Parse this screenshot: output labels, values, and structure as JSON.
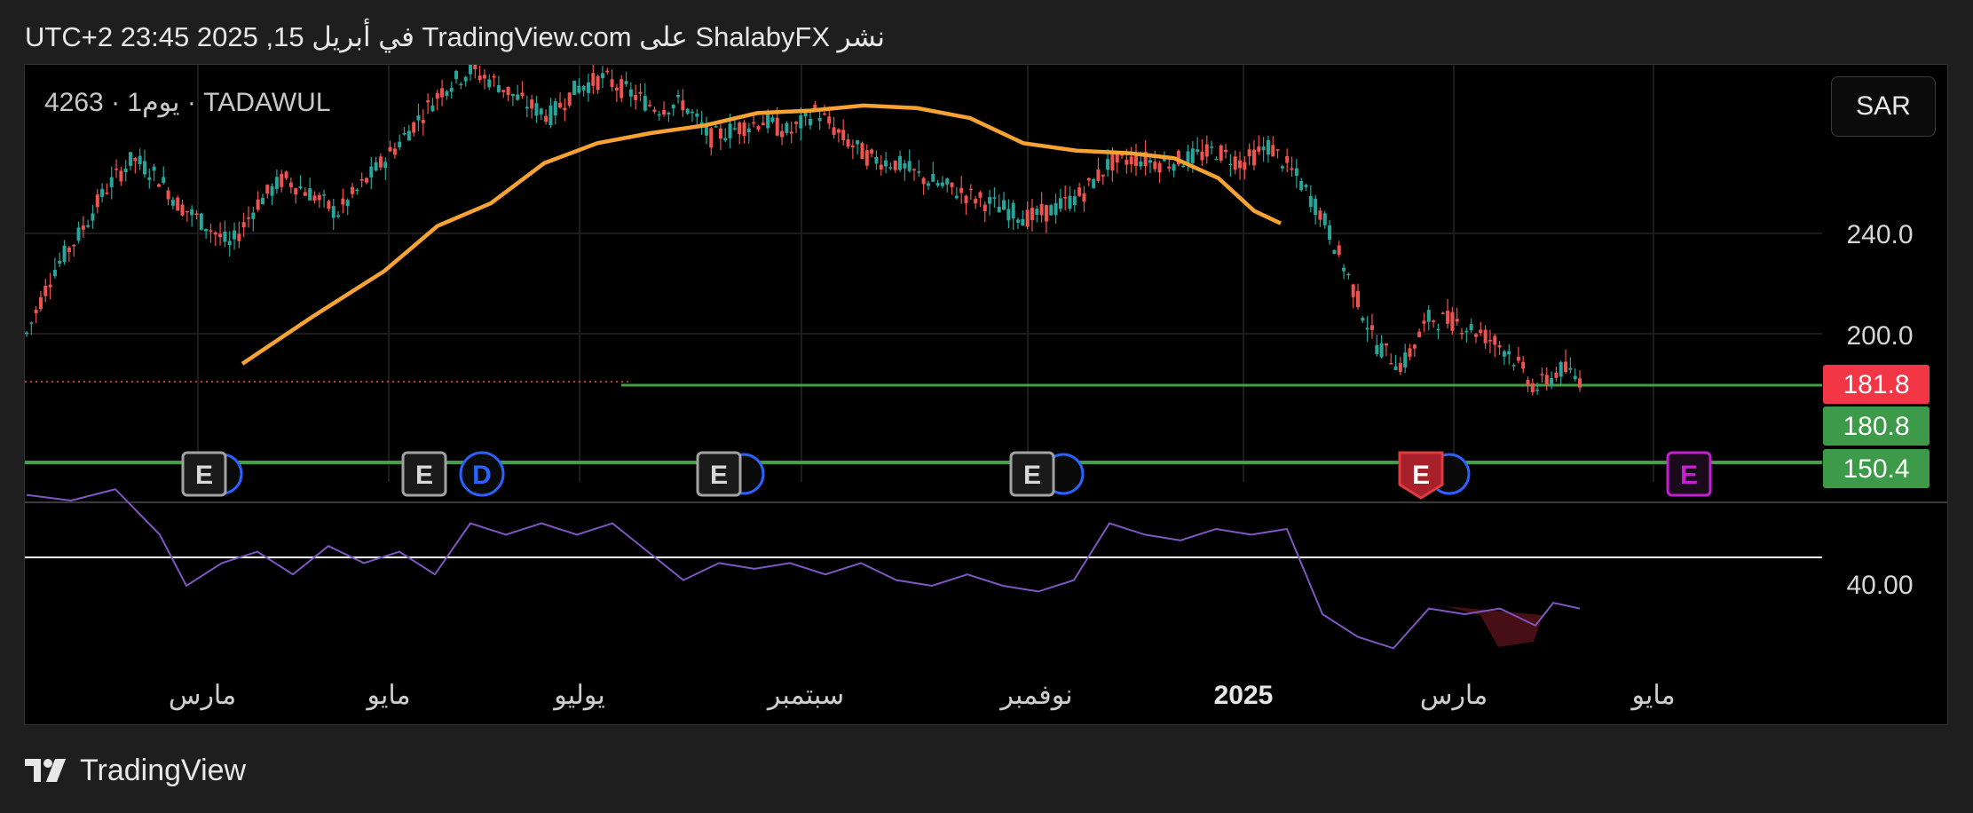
{
  "header": {
    "title": "نشر ShalabyFX على TradingView.com في أبريل 15, 2025 23:45 UTC+2"
  },
  "symbol": {
    "label": "4263 · يوم1 · TADAWUL"
  },
  "currency": "SAR",
  "footer": {
    "brand": "TradingView"
  },
  "colors": {
    "up": "#26a69a",
    "down": "#ef5350",
    "ma": "#f7a334",
    "rsi": "#7e57c2",
    "price_badge_red": "#f23645",
    "price_badge_green": "#3c9a48",
    "earnings_past": "#a3a3a3",
    "earnings_next": "#c41fd1",
    "earnings_miss": "#e03a3e",
    "dividend": "#2962ff"
  },
  "chart_data": {
    "type": "candlestick",
    "x_labels": [
      "مارس",
      "مايو",
      "يوليو",
      "سبتمبر",
      "نوفمبر",
      "2025",
      "مارس",
      "مايو"
    ],
    "y_ticks": [
      "240.0",
      "200.0"
    ],
    "ylim": [
      150,
      270
    ],
    "price_badges": [
      {
        "value": "181.8",
        "color": "red"
      },
      {
        "value": "180.8",
        "color": "green"
      },
      {
        "value": "150.4",
        "color": "green"
      }
    ],
    "moving_average": {
      "name": "",
      "points": [
        [
          0.0,
          188
        ],
        [
          0.08,
          207
        ],
        [
          0.16,
          225
        ],
        [
          0.22,
          243
        ],
        [
          0.28,
          252
        ],
        [
          0.34,
          268
        ],
        [
          0.4,
          276
        ],
        [
          0.46,
          280
        ],
        [
          0.52,
          283
        ],
        [
          0.58,
          288
        ],
        [
          0.64,
          289
        ],
        [
          0.7,
          291
        ],
        [
          0.76,
          290
        ],
        [
          0.82,
          286
        ],
        [
          0.88,
          276
        ],
        [
          0.94,
          273
        ],
        [
          1.0,
          272
        ],
        [
          1.05,
          270
        ],
        [
          1.1,
          262
        ],
        [
          1.14,
          249
        ],
        [
          1.17,
          244
        ]
      ]
    },
    "price_path": [
      [
        0.0,
        200
      ],
      [
        0.03,
        225
      ],
      [
        0.06,
        240
      ],
      [
        0.09,
        258
      ],
      [
        0.12,
        270
      ],
      [
        0.15,
        262
      ],
      [
        0.17,
        252
      ],
      [
        0.2,
        244
      ],
      [
        0.23,
        235
      ],
      [
        0.26,
        252
      ],
      [
        0.29,
        262
      ],
      [
        0.32,
        256
      ],
      [
        0.35,
        248
      ],
      [
        0.38,
        260
      ],
      [
        0.41,
        272
      ],
      [
        0.44,
        285
      ],
      [
        0.47,
        298
      ],
      [
        0.5,
        305
      ],
      [
        0.53,
        300
      ],
      [
        0.56,
        292
      ],
      [
        0.59,
        287
      ],
      [
        0.62,
        298
      ],
      [
        0.65,
        302
      ],
      [
        0.68,
        296
      ],
      [
        0.71,
        290
      ],
      [
        0.74,
        292
      ],
      [
        0.77,
        278
      ],
      [
        0.8,
        282
      ],
      [
        0.83,
        285
      ],
      [
        0.86,
        280
      ],
      [
        0.89,
        289
      ],
      [
        0.92,
        278
      ],
      [
        0.95,
        270
      ],
      [
        0.98,
        268
      ],
      [
        1.01,
        262
      ],
      [
        1.04,
        258
      ],
      [
        1.07,
        254
      ],
      [
        1.1,
        250
      ],
      [
        1.13,
        246
      ],
      [
        1.16,
        250
      ],
      [
        1.19,
        256
      ],
      [
        1.22,
        268
      ],
      [
        1.25,
        270
      ],
      [
        1.28,
        268
      ],
      [
        1.31,
        270
      ],
      [
        1.34,
        273
      ],
      [
        1.37,
        268
      ],
      [
        1.4,
        275
      ],
      [
        1.43,
        263
      ],
      [
        1.46,
        247
      ],
      [
        1.49,
        222
      ],
      [
        1.52,
        196
      ],
      [
        1.55,
        187
      ],
      [
        1.58,
        206
      ],
      [
        1.61,
        205
      ],
      [
        1.64,
        200
      ],
      [
        1.67,
        193
      ],
      [
        1.7,
        178
      ],
      [
        1.73,
        186
      ],
      [
        1.75,
        181.8
      ]
    ],
    "horizontal_lines": [
      {
        "value": 180.8,
        "color": "green"
      },
      {
        "value": 150.4,
        "color": "green"
      }
    ],
    "events": [
      {
        "type": "earnings",
        "label": "E",
        "style": "past"
      },
      {
        "type": "earnings",
        "label": "E",
        "style": "past"
      },
      {
        "type": "dividend",
        "label": "D"
      },
      {
        "type": "earnings",
        "label": "E",
        "style": "past"
      },
      {
        "type": "earnings",
        "label": "E",
        "style": "past"
      },
      {
        "type": "earnings",
        "label": "E",
        "style": "miss"
      },
      {
        "type": "earnings",
        "label": "E",
        "style": "next"
      }
    ],
    "rsi": {
      "tick": "40.00",
      "level_line": 50,
      "points": [
        [
          0.0,
          72
        ],
        [
          0.05,
          70
        ],
        [
          0.1,
          74
        ],
        [
          0.15,
          58
        ],
        [
          0.18,
          40
        ],
        [
          0.22,
          48
        ],
        [
          0.26,
          52
        ],
        [
          0.3,
          44
        ],
        [
          0.34,
          54
        ],
        [
          0.38,
          48
        ],
        [
          0.42,
          52
        ],
        [
          0.46,
          44
        ],
        [
          0.5,
          62
        ],
        [
          0.54,
          58
        ],
        [
          0.58,
          62
        ],
        [
          0.62,
          58
        ],
        [
          0.66,
          62
        ],
        [
          0.7,
          52
        ],
        [
          0.74,
          42
        ],
        [
          0.78,
          48
        ],
        [
          0.82,
          46
        ],
        [
          0.86,
          48
        ],
        [
          0.9,
          44
        ],
        [
          0.94,
          48
        ],
        [
          0.98,
          42
        ],
        [
          1.02,
          40
        ],
        [
          1.06,
          44
        ],
        [
          1.1,
          40
        ],
        [
          1.14,
          38
        ],
        [
          1.18,
          42
        ],
        [
          1.22,
          62
        ],
        [
          1.26,
          58
        ],
        [
          1.3,
          56
        ],
        [
          1.34,
          60
        ],
        [
          1.38,
          58
        ],
        [
          1.42,
          60
        ],
        [
          1.46,
          30
        ],
        [
          1.5,
          22
        ],
        [
          1.54,
          18
        ],
        [
          1.58,
          32
        ],
        [
          1.62,
          30
        ],
        [
          1.66,
          32
        ],
        [
          1.7,
          26
        ],
        [
          1.72,
          34
        ],
        [
          1.75,
          32
        ]
      ]
    }
  }
}
